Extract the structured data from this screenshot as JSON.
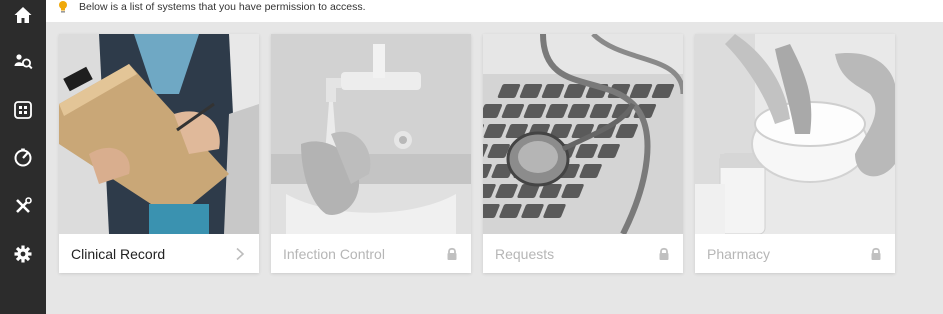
{
  "banner": {
    "message": "Below is a list of systems that you have permission to access.",
    "icon": "lightbulb-icon",
    "icon_color": "#f0a90a"
  },
  "sidebar": {
    "items": [
      {
        "icon": "home-icon"
      },
      {
        "icon": "patient-search-icon"
      },
      {
        "icon": "apps-grid-icon"
      },
      {
        "icon": "dashboard-gauge-icon"
      },
      {
        "icon": "tools-icon"
      },
      {
        "icon": "settings-gear-icon"
      }
    ]
  },
  "cards": [
    {
      "label": "Clinical Record",
      "status": "available",
      "icon": "chevron-right-icon"
    },
    {
      "label": "Infection Control",
      "status": "locked",
      "icon": "lock-icon"
    },
    {
      "label": "Requests",
      "status": "locked",
      "icon": "lock-icon"
    },
    {
      "label": "Pharmacy",
      "status": "locked",
      "icon": "lock-icon"
    }
  ],
  "colors": {
    "sidebar_bg": "#2c2c2c",
    "page_bg": "#e6e6e6",
    "locked_text": "#b6b6b6"
  }
}
